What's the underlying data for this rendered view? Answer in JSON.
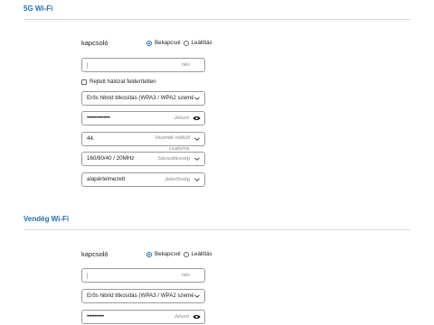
{
  "section_5g": {
    "title": "5G Wi-Fi",
    "toggle_label": "kapcsoló",
    "on_label": "Bekapcsol",
    "off_label": "Leállítás",
    "name_placeholder": "név",
    "hidden_network_label": "Rejtett hálózat felderítetlen",
    "encryption_value": "Erős hibrid titkosítás (WPA3 / WPA2 személ...",
    "encryption_placeholder": "Titkosítás",
    "password_dots": "•••••••••••••••",
    "password_placeholder": "Jelszó",
    "channel_value": "44.",
    "channel_placeholder_line1": "Vezeték nélküli",
    "channel_placeholder_line2": "csatorna",
    "bandwidth_value": "160/80/40 / 20MHz",
    "bandwidth_placeholder": "Sávszélesség",
    "priority_value": "alapértelmezett",
    "priority_placeholder": "Jelerősség"
  },
  "section_guest": {
    "title": "Vendég Wi-Fi",
    "toggle_label": "kapcsoló",
    "on_label": "Bekapcsol",
    "off_label": "Leállítás",
    "name_placeholder": "név",
    "encryption_value": "Erős hibrid titkosítás (WPA3 / WPA2 személ...",
    "encryption_placeholder": "Titkosítás",
    "password_dots": "•••••••••••",
    "password_placeholder": "Jelszó"
  },
  "colors": {
    "accent": "#1f6fb5",
    "border": "#9a9a9a",
    "divider": "#d9d9d9"
  },
  "icons": [
    "chevron-down-icon",
    "eye-icon"
  ]
}
